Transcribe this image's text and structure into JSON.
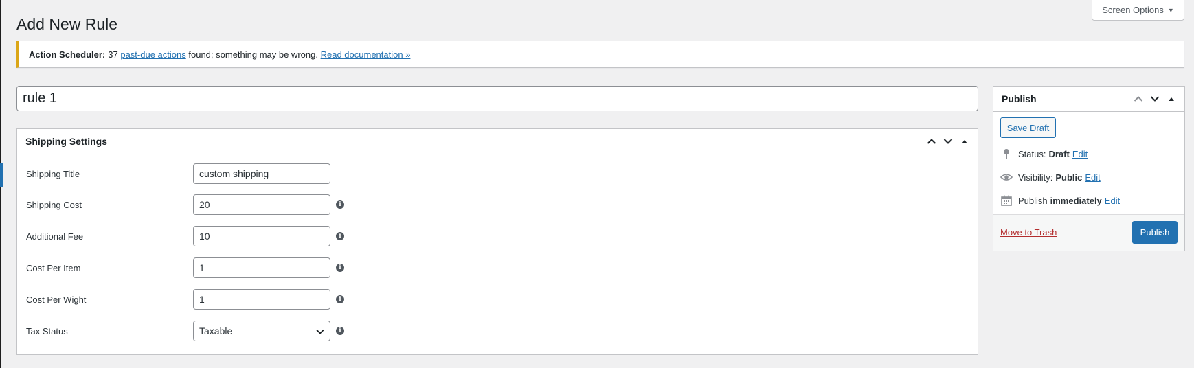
{
  "screen_options": {
    "label": "Screen Options"
  },
  "page": {
    "title": "Add New Rule"
  },
  "notice": {
    "prefix": "Action Scheduler:",
    "count": "37",
    "link1": "past-due actions",
    "middle": "found; something may be wrong.",
    "link2": "Read documentation »",
    "accent_color": "#dba617"
  },
  "title_field": {
    "value": "rule 1"
  },
  "shipping": {
    "heading": "Shipping Settings",
    "fields": [
      {
        "label": "Shipping Title",
        "value": "custom shipping"
      },
      {
        "label": "Shipping Cost",
        "value": "20"
      },
      {
        "label": "Additional Fee",
        "value": "10"
      },
      {
        "label": "Cost Per Item",
        "value": "1"
      },
      {
        "label": "Cost Per Wight",
        "value": "1"
      },
      {
        "label": "Tax Status",
        "value": "Taxable"
      }
    ],
    "info_glyph": "i"
  },
  "publish": {
    "heading": "Publish",
    "save_draft": "Save Draft",
    "status_label": "Status:",
    "status_value": "Draft",
    "visibility_label": "Visibility:",
    "visibility_value": "Public",
    "schedule_label": "Publish",
    "schedule_value": "immediately",
    "edit": "Edit",
    "trash": "Move to Trash",
    "publish_button": "Publish",
    "primary_color": "#2271b1"
  },
  "icons": [
    "chevron-up-icon",
    "chevron-down-icon",
    "collapse-arrow-icon",
    "pin-icon",
    "eye-icon",
    "calendar-icon",
    "info-icon",
    "select-chevron-icon"
  ]
}
